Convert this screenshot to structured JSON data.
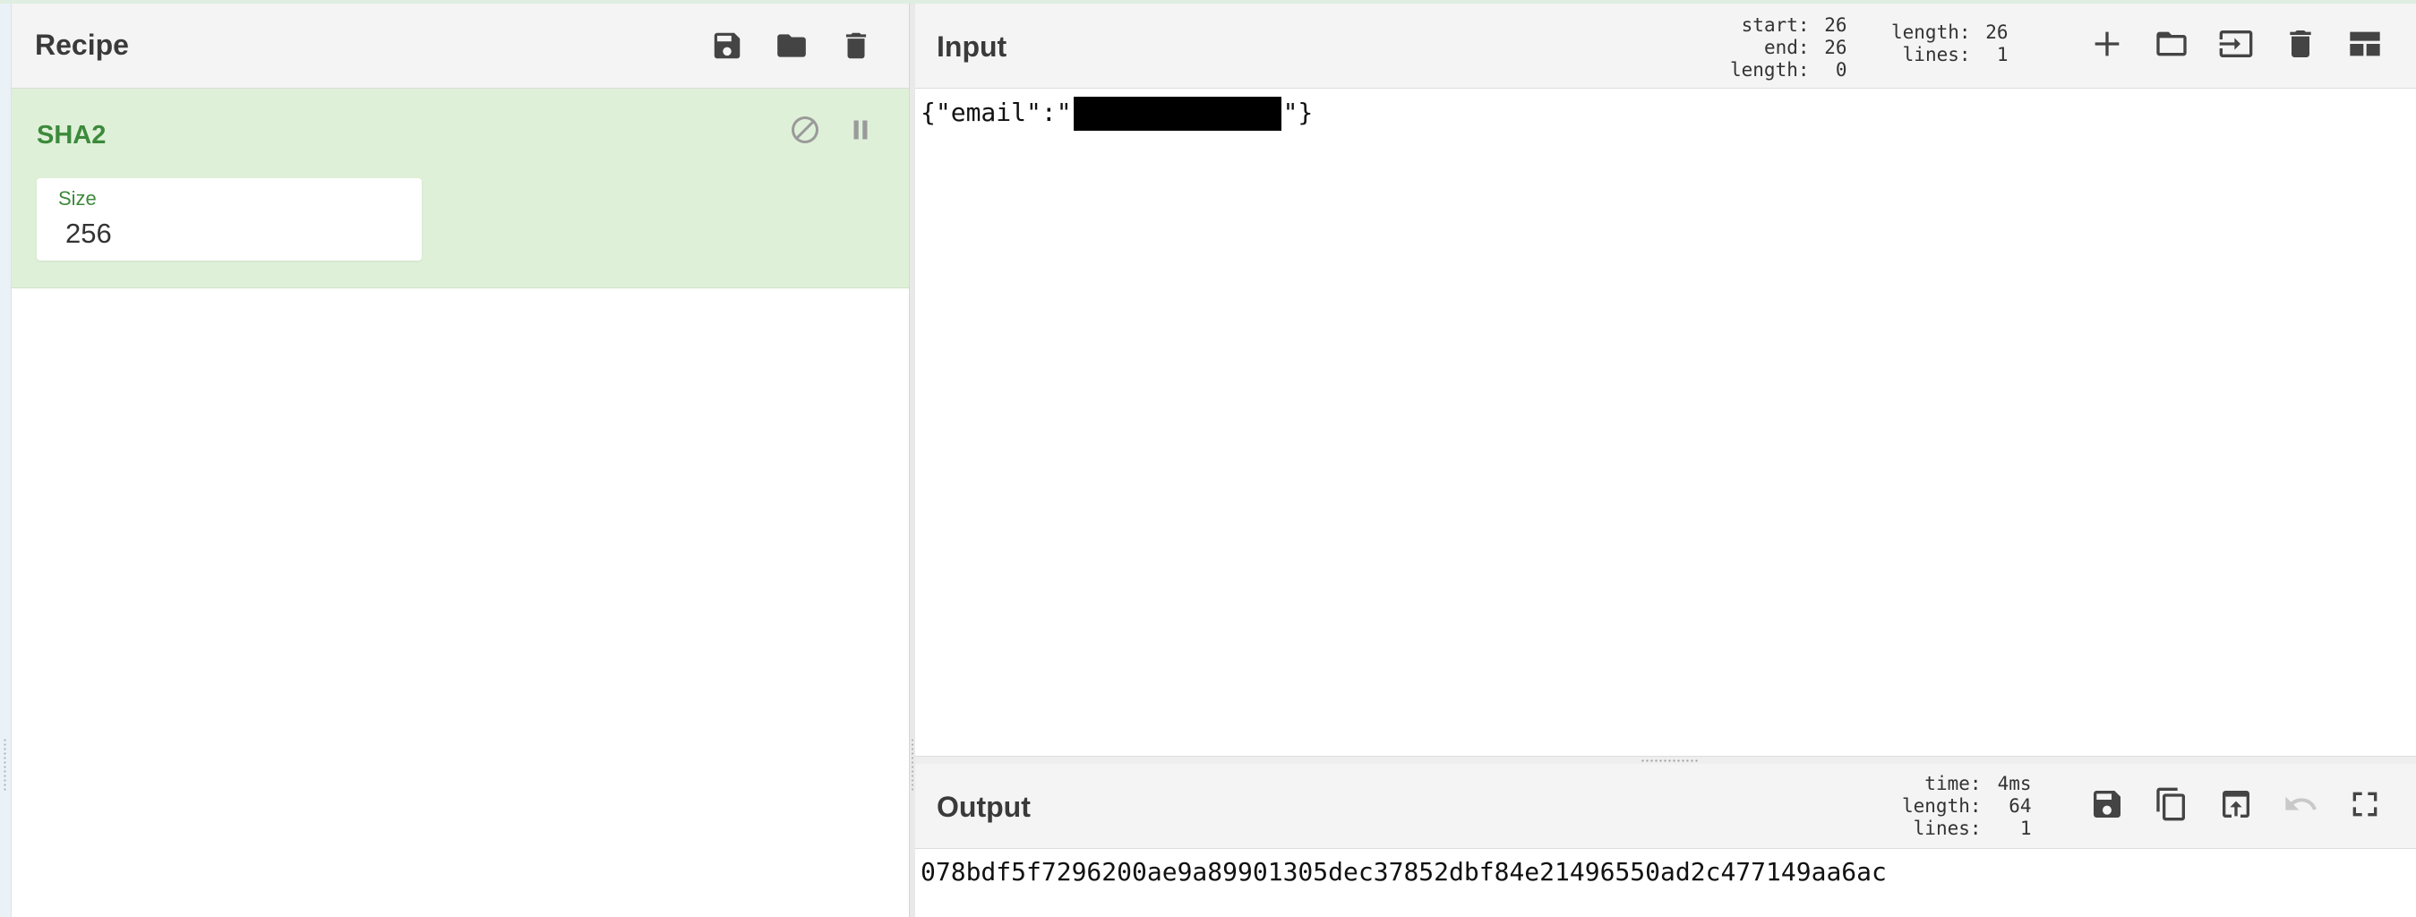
{
  "recipe": {
    "title": "Recipe",
    "icons": [
      "save-icon",
      "folder-icon",
      "trash-icon"
    ],
    "operation": {
      "name": "SHA2",
      "field_label": "Size",
      "field_value": "256",
      "controls": [
        "disable-icon",
        "pause-icon"
      ]
    }
  },
  "input": {
    "title": "Input",
    "selection": {
      "start_label": "start:",
      "start": "26",
      "end_label": "end:",
      "end": "26",
      "length_label": "length:",
      "length": "0"
    },
    "summary": {
      "length_label": "length:",
      "length": "26",
      "lines_label": "lines:",
      "lines": "1"
    },
    "icons": [
      "plus-icon",
      "folder-icon",
      "insert-icon",
      "trash-icon",
      "layout-icon"
    ],
    "text_prefix": "{\"email\":\"",
    "text_suffix": "\"}"
  },
  "output": {
    "title": "Output",
    "stats": {
      "time_label": "time:",
      "time": "4ms",
      "length_label": "length:",
      "length": "64",
      "lines_label": "lines:",
      "lines": "1"
    },
    "icons": [
      "save-icon",
      "copy-icon",
      "move-to-input-icon",
      "undo-icon",
      "fullscreen-icon"
    ],
    "text": "078bdf5f7296200ae9a89901305dec37852dbf84e21496550ad2c477149aa6ac"
  }
}
